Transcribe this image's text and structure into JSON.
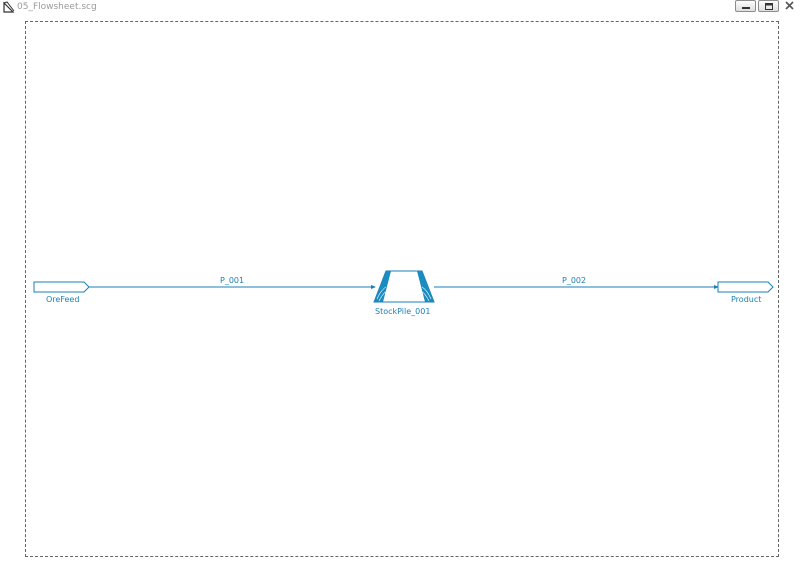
{
  "window": {
    "title": "05_Flowsheet.scg",
    "icon": "flowsheet-icon",
    "controls": [
      "minimize-icon",
      "restore-icon",
      "close-icon"
    ]
  },
  "flowsheet": {
    "feed": {
      "label": "OreFeed",
      "icon": "feeder-icon"
    },
    "unit": {
      "label": "StockPile_001",
      "icon": "stockpile-icon"
    },
    "product": {
      "label": "Product",
      "icon": "product-icon"
    },
    "streams": [
      {
        "label": "P_001"
      },
      {
        "label": "P_002"
      }
    ],
    "colors": {
      "stream": "#1a7fb5",
      "unit_fill": "#1a8cc0",
      "border": "#666666"
    }
  }
}
